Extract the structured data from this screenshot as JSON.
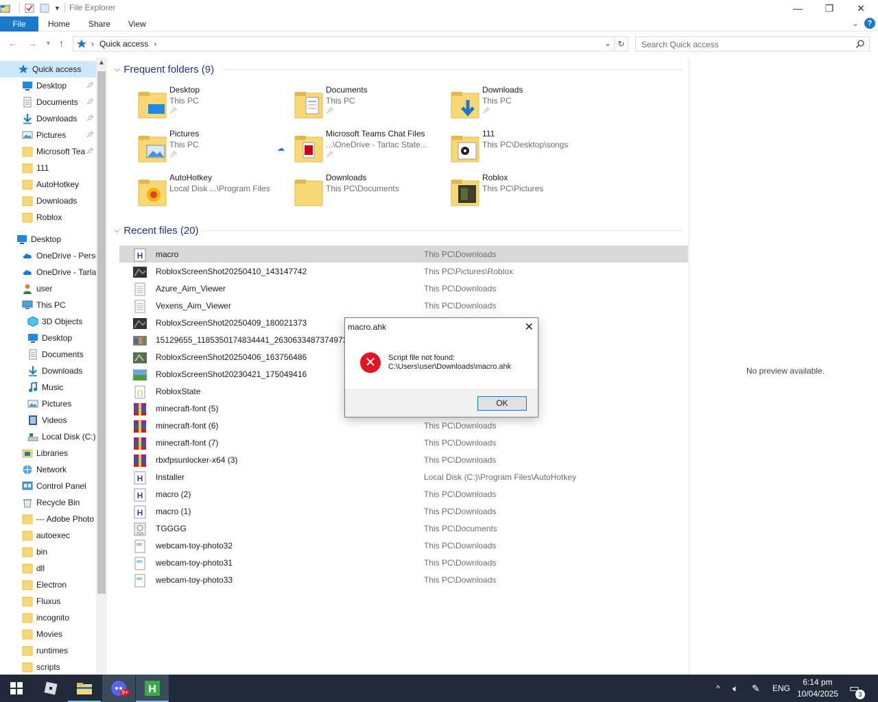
{
  "window": {
    "title": "File Explorer",
    "minimize_glyph": "—",
    "maximize_glyph": "❐",
    "close_glyph": "✕"
  },
  "ribbon": {
    "tabs": [
      "File",
      "Home",
      "Share",
      "View"
    ],
    "help": "?"
  },
  "address": {
    "breadcrumb": "Quick access",
    "search_placeholder": "Search Quick access"
  },
  "sidebar": {
    "items": [
      {
        "label": "Quick access",
        "icon": "star-icon",
        "pinned": false,
        "selected": true
      },
      {
        "label": "Desktop",
        "icon": "desktop-icon",
        "pinned": true
      },
      {
        "label": "Documents",
        "icon": "documents-icon",
        "pinned": true
      },
      {
        "label": "Downloads",
        "icon": "download-icon",
        "pinned": true
      },
      {
        "label": "Pictures",
        "icon": "pictures-icon",
        "pinned": true
      },
      {
        "label": "Microsoft Tea",
        "icon": "folder-icon",
        "pinned": true
      },
      {
        "label": "111",
        "icon": "folder-icon",
        "pinned": false
      },
      {
        "label": "AutoHotkey",
        "icon": "folder-icon",
        "pinned": false
      },
      {
        "label": "Downloads",
        "icon": "folder-icon",
        "pinned": false
      },
      {
        "label": "Roblox",
        "icon": "folder-icon",
        "pinned": false
      },
      {
        "label": "Desktop",
        "icon": "desktop-icon",
        "pinned": false
      },
      {
        "label": "OneDrive - Perso",
        "icon": "cloud-icon",
        "pinned": false
      },
      {
        "label": "OneDrive - Tarla",
        "icon": "cloud-icon",
        "pinned": false
      },
      {
        "label": "user",
        "icon": "user-icon",
        "pinned": false
      },
      {
        "label": "This PC",
        "icon": "pc-icon",
        "pinned": false
      },
      {
        "label": "3D Objects",
        "icon": "cube-icon",
        "pinned": false
      },
      {
        "label": "Desktop",
        "icon": "desktop-icon",
        "pinned": false
      },
      {
        "label": "Documents",
        "icon": "documents-icon",
        "pinned": false
      },
      {
        "label": "Downloads",
        "icon": "download-icon",
        "pinned": false
      },
      {
        "label": "Music",
        "icon": "music-icon",
        "pinned": false
      },
      {
        "label": "Pictures",
        "icon": "pictures-icon",
        "pinned": false
      },
      {
        "label": "Videos",
        "icon": "videos-icon",
        "pinned": false
      },
      {
        "label": "Local Disk (C:)",
        "icon": "disk-icon",
        "pinned": false
      },
      {
        "label": "Libraries",
        "icon": "libraries-icon",
        "pinned": false
      },
      {
        "label": "Network",
        "icon": "network-icon",
        "pinned": false
      },
      {
        "label": "Control Panel",
        "icon": "control-panel-icon",
        "pinned": false
      },
      {
        "label": "Recycle Bin",
        "icon": "recycle-bin-icon",
        "pinned": false
      },
      {
        "label": "--- Adobe Photo",
        "icon": "folder-icon",
        "pinned": false
      },
      {
        "label": "autoexec",
        "icon": "folder-icon",
        "pinned": false
      },
      {
        "label": "bin",
        "icon": "folder-icon",
        "pinned": false
      },
      {
        "label": "dll",
        "icon": "folder-icon",
        "pinned": false
      },
      {
        "label": "Electron",
        "icon": "folder-icon",
        "pinned": false
      },
      {
        "label": "Fluxus",
        "icon": "folder-icon",
        "pinned": false
      },
      {
        "label": "incognito",
        "icon": "folder-icon",
        "pinned": false
      },
      {
        "label": "Movies",
        "icon": "folder-icon",
        "pinned": false
      },
      {
        "label": "runtimes",
        "icon": "folder-icon",
        "pinned": false
      },
      {
        "label": "scripts",
        "icon": "folder-icon",
        "pinned": false
      }
    ]
  },
  "frequent": {
    "heading": "Frequent folders (9)",
    "folders": [
      {
        "name": "Desktop",
        "sub": "This PC",
        "pinned": true,
        "overlay": "desktop"
      },
      {
        "name": "Documents",
        "sub": "This PC",
        "pinned": true,
        "overlay": "documents"
      },
      {
        "name": "Downloads",
        "sub": "This PC",
        "pinned": true,
        "overlay": "download"
      },
      {
        "name": "Pictures",
        "sub": "This PC",
        "pinned": true,
        "overlay": "pictures"
      },
      {
        "name": "Microsoft Teams Chat Files",
        "sub": "...\\OneDrive - Tarlac State...",
        "pinned": true,
        "overlay": "pdf",
        "cloud": true
      },
      {
        "name": "111",
        "sub": "This PC\\Desktop\\songs",
        "pinned": false,
        "overlay": "media"
      },
      {
        "name": "AutoHotkey",
        "sub": "Local Disk ...\\Program Files",
        "pinned": false,
        "overlay": "ahk"
      },
      {
        "name": "Downloads",
        "sub": "This PC\\Documents",
        "pinned": false,
        "overlay": "plain"
      },
      {
        "name": "Roblox",
        "sub": "This PC\\Pictures",
        "pinned": false,
        "overlay": "photo"
      }
    ]
  },
  "recent": {
    "heading": "Recent files (20)",
    "files": [
      {
        "name": "macro",
        "location": "This PC\\Downloads",
        "type": "ahk",
        "selected": true
      },
      {
        "name": "RobloxScreenShot20250410_143147742",
        "location": "This PC\\Pictures\\Roblox",
        "type": "image-dark"
      },
      {
        "name": "Azure_Aim_Viewer",
        "location": "This PC\\Downloads",
        "type": "text"
      },
      {
        "name": "Vexens_Aim_Viewer",
        "location": "This PC\\Downloads",
        "type": "text"
      },
      {
        "name": "RobloxScreenShot20250409_180021373",
        "location": "",
        "type": "image-dark"
      },
      {
        "name": "15129655_1185350174834441_2630633487374973648_o",
        "location": "",
        "type": "image-photo"
      },
      {
        "name": "RobloxScreenShot20250406_163756486",
        "location": "",
        "type": "image-green"
      },
      {
        "name": "RobloxScreenShot20230421_175049416",
        "location": "",
        "type": "image-grass"
      },
      {
        "name": "RobloxState",
        "location": "",
        "type": "json"
      },
      {
        "name": "minecraft-font (5)",
        "location": "",
        "type": "rar"
      },
      {
        "name": "minecraft-font (6)",
        "location": "This PC\\Downloads",
        "type": "rar"
      },
      {
        "name": "minecraft-font (7)",
        "location": "This PC\\Downloads",
        "type": "rar"
      },
      {
        "name": "rbxfpsunlocker-x64 (3)",
        "location": "This PC\\Downloads",
        "type": "rar"
      },
      {
        "name": "Installer",
        "location": "Local Disk (C:)\\Program Files\\AutoHotkey",
        "type": "ahk"
      },
      {
        "name": "macro (2)",
        "location": "This PC\\Downloads",
        "type": "ahk"
      },
      {
        "name": "macro (1)",
        "location": "This PC\\Downloads",
        "type": "ahk"
      },
      {
        "name": "TGGGG",
        "location": "This PC\\Documents",
        "type": "tga"
      },
      {
        "name": "webcam-toy-photo32",
        "location": "This PC\\Downloads",
        "type": "jpg"
      },
      {
        "name": "webcam-toy-photo31",
        "location": "This PC\\Downloads",
        "type": "jpg"
      },
      {
        "name": "webcam-toy-photo33",
        "location": "This PC\\Downloads",
        "type": "jpg"
      }
    ]
  },
  "preview": {
    "text": "No preview available."
  },
  "dialog": {
    "title": "macro.ahk",
    "close_glyph": "✕",
    "error_glyph": "✕",
    "message_line1": "Script file not found:",
    "message_line2": "C:\\Users\\user\\Downloads\\macro.ahk",
    "ok_label": "OK"
  },
  "taskbar": {
    "language": "ENG",
    "time": "6:14 pm",
    "date": "10/04/2025",
    "notification_count": "3",
    "discord_badge": "9+"
  }
}
